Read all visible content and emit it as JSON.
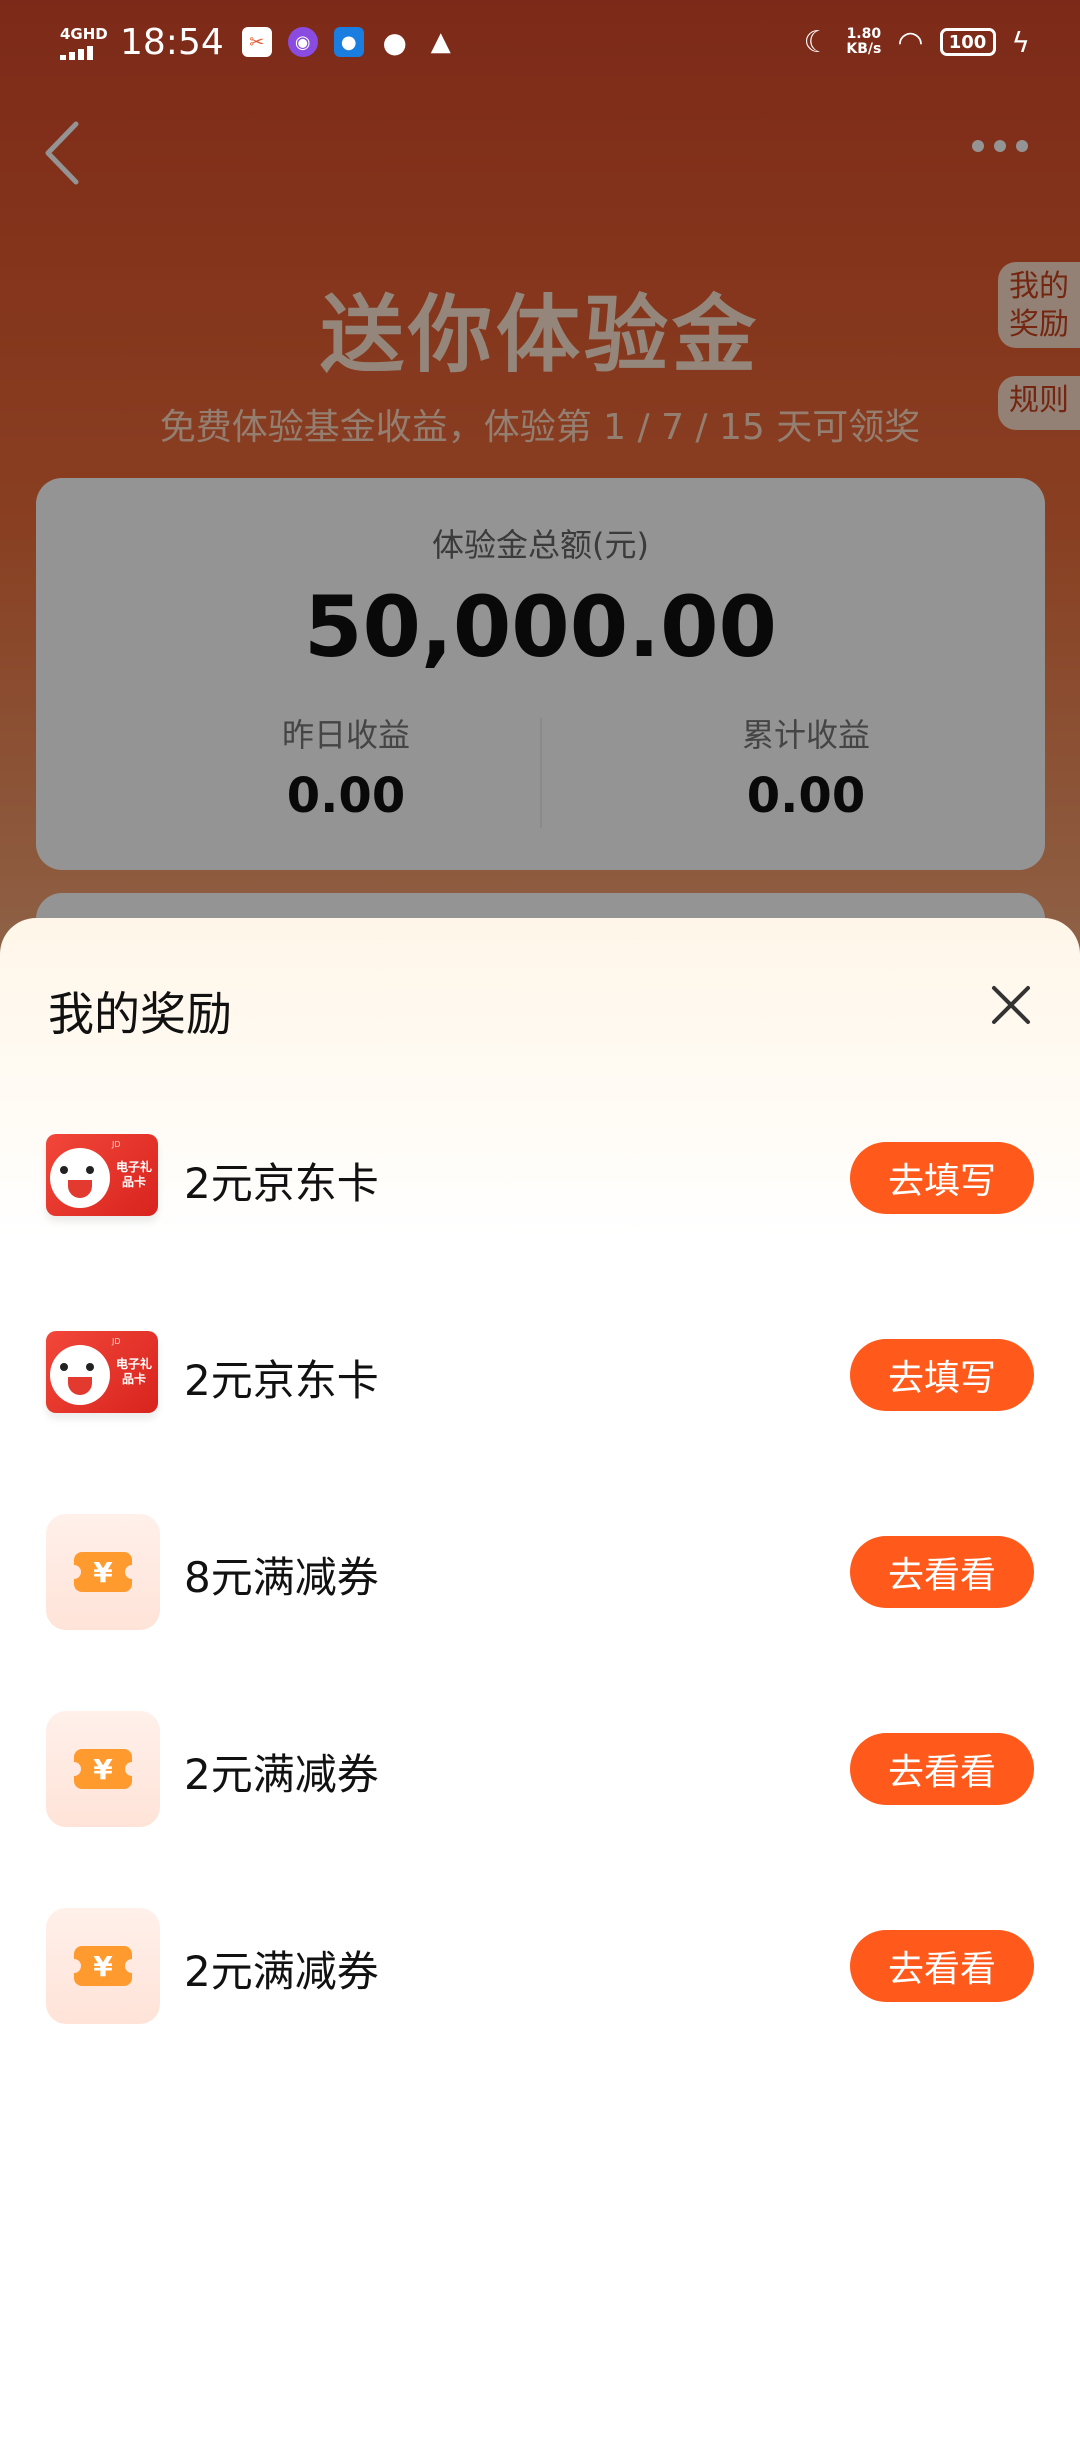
{
  "status_bar": {
    "network": "4GHD",
    "time": "18:54",
    "speed_value": "1.80",
    "speed_unit": "KB/s",
    "battery": "100"
  },
  "header": {
    "title": "送你体验金",
    "subtitle": "免费体验基金收益，体验第 1 / 7 / 15 天可领奖",
    "side_rewards": "我的奖励",
    "side_rules": "规则"
  },
  "summary": {
    "total_label": "体验金总额(元)",
    "total_amount": "50,000.00",
    "yesterday_label": "昨日收益",
    "yesterday_value": "0.00",
    "cumulative_label": "累计收益",
    "cumulative_value": "0.00"
  },
  "sheet": {
    "title": "我的奖励",
    "items": [
      {
        "icon": "jd-gift-card-icon",
        "name": "2元京东卡",
        "action": "去填写",
        "card_text": "电子礼品卡"
      },
      {
        "icon": "jd-gift-card-icon",
        "name": "2元京东卡",
        "action": "去填写",
        "card_text": "电子礼品卡"
      },
      {
        "icon": "coupon-icon",
        "name": "8元满减券",
        "action": "去看看",
        "symbol": "¥"
      },
      {
        "icon": "coupon-icon",
        "name": "2元满减券",
        "action": "去看看",
        "symbol": "¥"
      },
      {
        "icon": "coupon-icon",
        "name": "2元满减券",
        "action": "去看看",
        "symbol": "¥"
      }
    ]
  },
  "colors": {
    "accent": "#ff5a1c",
    "header_bg": "#e45b30"
  }
}
